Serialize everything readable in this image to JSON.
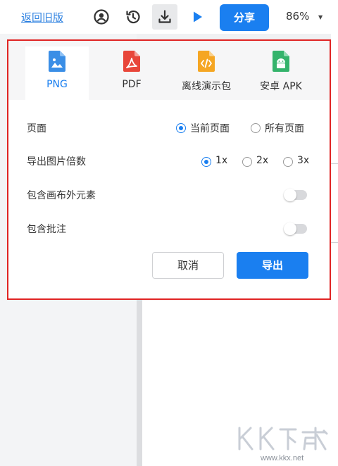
{
  "toolbar": {
    "back_label": "返回旧版",
    "share_label": "分享",
    "zoom": "86%",
    "icons": [
      "user-circle-icon",
      "history-icon",
      "download-icon",
      "play-icon",
      "caret-down-icon"
    ],
    "colors": {
      "accent": "#1a7ff0",
      "highlight_border": "#e02424"
    }
  },
  "export_dialog": {
    "tabs": [
      {
        "label": "PNG",
        "icon": "image-file-icon",
        "color": "#3a8ee6",
        "active": true
      },
      {
        "label": "PDF",
        "icon": "pdf-file-icon",
        "color": "#e8463a",
        "active": false
      },
      {
        "label": "离线演示包",
        "icon": "code-file-icon",
        "color": "#f5a623",
        "active": false
      },
      {
        "label": "安卓 APK",
        "icon": "android-file-icon",
        "color": "#34b36b",
        "active": false
      }
    ],
    "page": {
      "label": "页面",
      "options": [
        "当前页面",
        "所有页面"
      ],
      "selected": "当前页面"
    },
    "scale": {
      "label": "导出图片倍数",
      "options": [
        "1x",
        "2x",
        "3x"
      ],
      "selected": "1x"
    },
    "include_outside": {
      "label": "包含画布外元素",
      "enabled": false
    },
    "include_comments": {
      "label": "包含批注",
      "enabled": false
    },
    "cancel_label": "取消",
    "export_label": "导出"
  },
  "watermark": {
    "logo": "KK下载",
    "url": "www.kkx.net"
  }
}
